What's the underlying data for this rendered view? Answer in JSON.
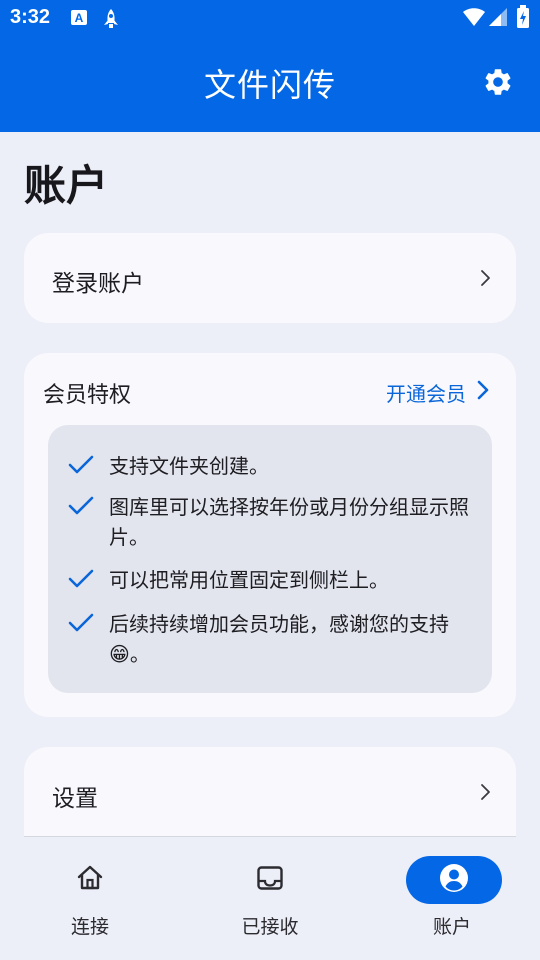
{
  "status_bar": {
    "time": "3:32",
    "icons": [
      "text-a-icon",
      "rocket-icon",
      "wifi-icon",
      "signal-icon",
      "battery-icon"
    ]
  },
  "app_bar": {
    "title": "文件闪传",
    "settings_icon": "gear-icon"
  },
  "page": {
    "title": "账户"
  },
  "login": {
    "label": "登录账户"
  },
  "vip": {
    "title": "会员特权",
    "link_label": "开通会员",
    "perks": [
      "支持文件夹创建。",
      "图库里可以选择按年份或月份分组显示照片。",
      "可以把常用位置固定到侧栏上。",
      "后续持续增加会员功能，感谢您的支持😁。"
    ]
  },
  "settings": {
    "label": "设置"
  },
  "bottom_nav": {
    "items": [
      {
        "label": "连接",
        "icon": "home-icon",
        "active": false
      },
      {
        "label": "已接收",
        "icon": "inbox-icon",
        "active": false
      },
      {
        "label": "账户",
        "icon": "account-icon",
        "active": true
      }
    ]
  },
  "colors": {
    "primary": "#0468e6",
    "background": "#eceef8",
    "card": "#f8f8fd",
    "perk_box": "#e3e5ee",
    "link": "#0a66d9"
  }
}
